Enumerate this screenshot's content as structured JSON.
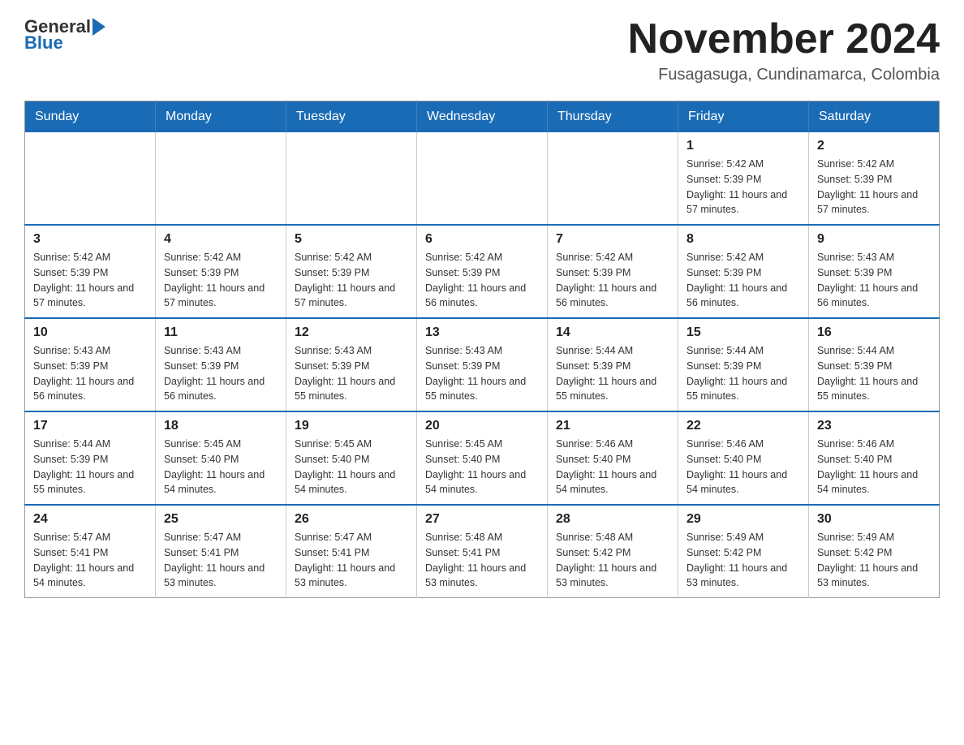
{
  "header": {
    "logo_general": "General",
    "logo_blue": "Blue",
    "month_year": "November 2024",
    "location": "Fusagasuga, Cundinamarca, Colombia"
  },
  "weekdays": [
    "Sunday",
    "Monday",
    "Tuesday",
    "Wednesday",
    "Thursday",
    "Friday",
    "Saturday"
  ],
  "weeks": [
    [
      {
        "day": "",
        "sunrise": "",
        "sunset": "",
        "daylight": ""
      },
      {
        "day": "",
        "sunrise": "",
        "sunset": "",
        "daylight": ""
      },
      {
        "day": "",
        "sunrise": "",
        "sunset": "",
        "daylight": ""
      },
      {
        "day": "",
        "sunrise": "",
        "sunset": "",
        "daylight": ""
      },
      {
        "day": "",
        "sunrise": "",
        "sunset": "",
        "daylight": ""
      },
      {
        "day": "1",
        "sunrise": "Sunrise: 5:42 AM",
        "sunset": "Sunset: 5:39 PM",
        "daylight": "Daylight: 11 hours and 57 minutes."
      },
      {
        "day": "2",
        "sunrise": "Sunrise: 5:42 AM",
        "sunset": "Sunset: 5:39 PM",
        "daylight": "Daylight: 11 hours and 57 minutes."
      }
    ],
    [
      {
        "day": "3",
        "sunrise": "Sunrise: 5:42 AM",
        "sunset": "Sunset: 5:39 PM",
        "daylight": "Daylight: 11 hours and 57 minutes."
      },
      {
        "day": "4",
        "sunrise": "Sunrise: 5:42 AM",
        "sunset": "Sunset: 5:39 PM",
        "daylight": "Daylight: 11 hours and 57 minutes."
      },
      {
        "day": "5",
        "sunrise": "Sunrise: 5:42 AM",
        "sunset": "Sunset: 5:39 PM",
        "daylight": "Daylight: 11 hours and 57 minutes."
      },
      {
        "day": "6",
        "sunrise": "Sunrise: 5:42 AM",
        "sunset": "Sunset: 5:39 PM",
        "daylight": "Daylight: 11 hours and 56 minutes."
      },
      {
        "day": "7",
        "sunrise": "Sunrise: 5:42 AM",
        "sunset": "Sunset: 5:39 PM",
        "daylight": "Daylight: 11 hours and 56 minutes."
      },
      {
        "day": "8",
        "sunrise": "Sunrise: 5:42 AM",
        "sunset": "Sunset: 5:39 PM",
        "daylight": "Daylight: 11 hours and 56 minutes."
      },
      {
        "day": "9",
        "sunrise": "Sunrise: 5:43 AM",
        "sunset": "Sunset: 5:39 PM",
        "daylight": "Daylight: 11 hours and 56 minutes."
      }
    ],
    [
      {
        "day": "10",
        "sunrise": "Sunrise: 5:43 AM",
        "sunset": "Sunset: 5:39 PM",
        "daylight": "Daylight: 11 hours and 56 minutes."
      },
      {
        "day": "11",
        "sunrise": "Sunrise: 5:43 AM",
        "sunset": "Sunset: 5:39 PM",
        "daylight": "Daylight: 11 hours and 56 minutes."
      },
      {
        "day": "12",
        "sunrise": "Sunrise: 5:43 AM",
        "sunset": "Sunset: 5:39 PM",
        "daylight": "Daylight: 11 hours and 55 minutes."
      },
      {
        "day": "13",
        "sunrise": "Sunrise: 5:43 AM",
        "sunset": "Sunset: 5:39 PM",
        "daylight": "Daylight: 11 hours and 55 minutes."
      },
      {
        "day": "14",
        "sunrise": "Sunrise: 5:44 AM",
        "sunset": "Sunset: 5:39 PM",
        "daylight": "Daylight: 11 hours and 55 minutes."
      },
      {
        "day": "15",
        "sunrise": "Sunrise: 5:44 AM",
        "sunset": "Sunset: 5:39 PM",
        "daylight": "Daylight: 11 hours and 55 minutes."
      },
      {
        "day": "16",
        "sunrise": "Sunrise: 5:44 AM",
        "sunset": "Sunset: 5:39 PM",
        "daylight": "Daylight: 11 hours and 55 minutes."
      }
    ],
    [
      {
        "day": "17",
        "sunrise": "Sunrise: 5:44 AM",
        "sunset": "Sunset: 5:39 PM",
        "daylight": "Daylight: 11 hours and 55 minutes."
      },
      {
        "day": "18",
        "sunrise": "Sunrise: 5:45 AM",
        "sunset": "Sunset: 5:40 PM",
        "daylight": "Daylight: 11 hours and 54 minutes."
      },
      {
        "day": "19",
        "sunrise": "Sunrise: 5:45 AM",
        "sunset": "Sunset: 5:40 PM",
        "daylight": "Daylight: 11 hours and 54 minutes."
      },
      {
        "day": "20",
        "sunrise": "Sunrise: 5:45 AM",
        "sunset": "Sunset: 5:40 PM",
        "daylight": "Daylight: 11 hours and 54 minutes."
      },
      {
        "day": "21",
        "sunrise": "Sunrise: 5:46 AM",
        "sunset": "Sunset: 5:40 PM",
        "daylight": "Daylight: 11 hours and 54 minutes."
      },
      {
        "day": "22",
        "sunrise": "Sunrise: 5:46 AM",
        "sunset": "Sunset: 5:40 PM",
        "daylight": "Daylight: 11 hours and 54 minutes."
      },
      {
        "day": "23",
        "sunrise": "Sunrise: 5:46 AM",
        "sunset": "Sunset: 5:40 PM",
        "daylight": "Daylight: 11 hours and 54 minutes."
      }
    ],
    [
      {
        "day": "24",
        "sunrise": "Sunrise: 5:47 AM",
        "sunset": "Sunset: 5:41 PM",
        "daylight": "Daylight: 11 hours and 54 minutes."
      },
      {
        "day": "25",
        "sunrise": "Sunrise: 5:47 AM",
        "sunset": "Sunset: 5:41 PM",
        "daylight": "Daylight: 11 hours and 53 minutes."
      },
      {
        "day": "26",
        "sunrise": "Sunrise: 5:47 AM",
        "sunset": "Sunset: 5:41 PM",
        "daylight": "Daylight: 11 hours and 53 minutes."
      },
      {
        "day": "27",
        "sunrise": "Sunrise: 5:48 AM",
        "sunset": "Sunset: 5:41 PM",
        "daylight": "Daylight: 11 hours and 53 minutes."
      },
      {
        "day": "28",
        "sunrise": "Sunrise: 5:48 AM",
        "sunset": "Sunset: 5:42 PM",
        "daylight": "Daylight: 11 hours and 53 minutes."
      },
      {
        "day": "29",
        "sunrise": "Sunrise: 5:49 AM",
        "sunset": "Sunset: 5:42 PM",
        "daylight": "Daylight: 11 hours and 53 minutes."
      },
      {
        "day": "30",
        "sunrise": "Sunrise: 5:49 AM",
        "sunset": "Sunset: 5:42 PM",
        "daylight": "Daylight: 11 hours and 53 minutes."
      }
    ]
  ]
}
